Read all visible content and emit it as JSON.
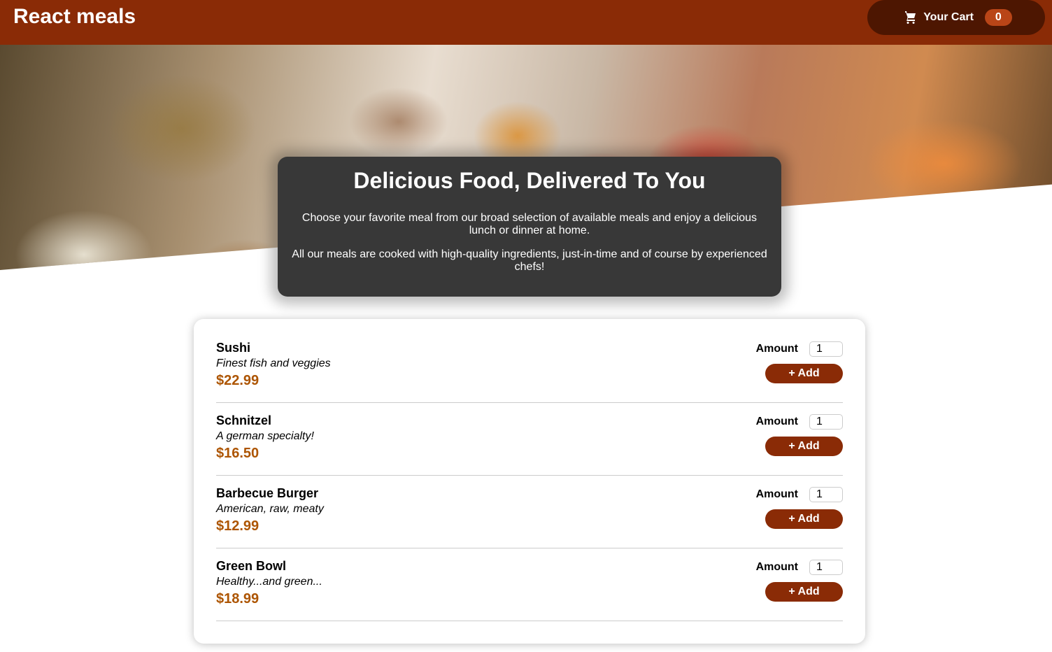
{
  "header": {
    "title": "React meals",
    "cart_label": "Your Cart",
    "cart_count": "0"
  },
  "summary": {
    "heading": "Delicious Food, Delivered To You",
    "paragraph1": "Choose your favorite meal from our broad selection of available meals and enjoy a delicious lunch or dinner at home.",
    "paragraph2": "All our meals are cooked with high-quality ingredients, just-in-time and of course by experienced chefs!"
  },
  "meals": [
    {
      "name": "Sushi",
      "description": "Finest fish and veggies",
      "price": "$22.99",
      "amount_label": "Amount",
      "amount_value": "1",
      "add_label": "+ Add"
    },
    {
      "name": "Schnitzel",
      "description": "A german specialty!",
      "price": "$16.50",
      "amount_label": "Amount",
      "amount_value": "1",
      "add_label": "+ Add"
    },
    {
      "name": "Barbecue Burger",
      "description": "American, raw, meaty",
      "price": "$12.99",
      "amount_label": "Amount",
      "amount_value": "1",
      "add_label": "+ Add"
    },
    {
      "name": "Green Bowl",
      "description": "Healthy...and green...",
      "price": "$18.99",
      "amount_label": "Amount",
      "amount_value": "1",
      "add_label": "+ Add"
    }
  ],
  "colors": {
    "header_bg": "#8a2b06",
    "cart_bg": "#4d1601",
    "badge_bg": "#b94517",
    "price": "#ad5502",
    "summary_bg": "#383838"
  },
  "icons": {
    "cart": "shopping-cart-icon"
  }
}
